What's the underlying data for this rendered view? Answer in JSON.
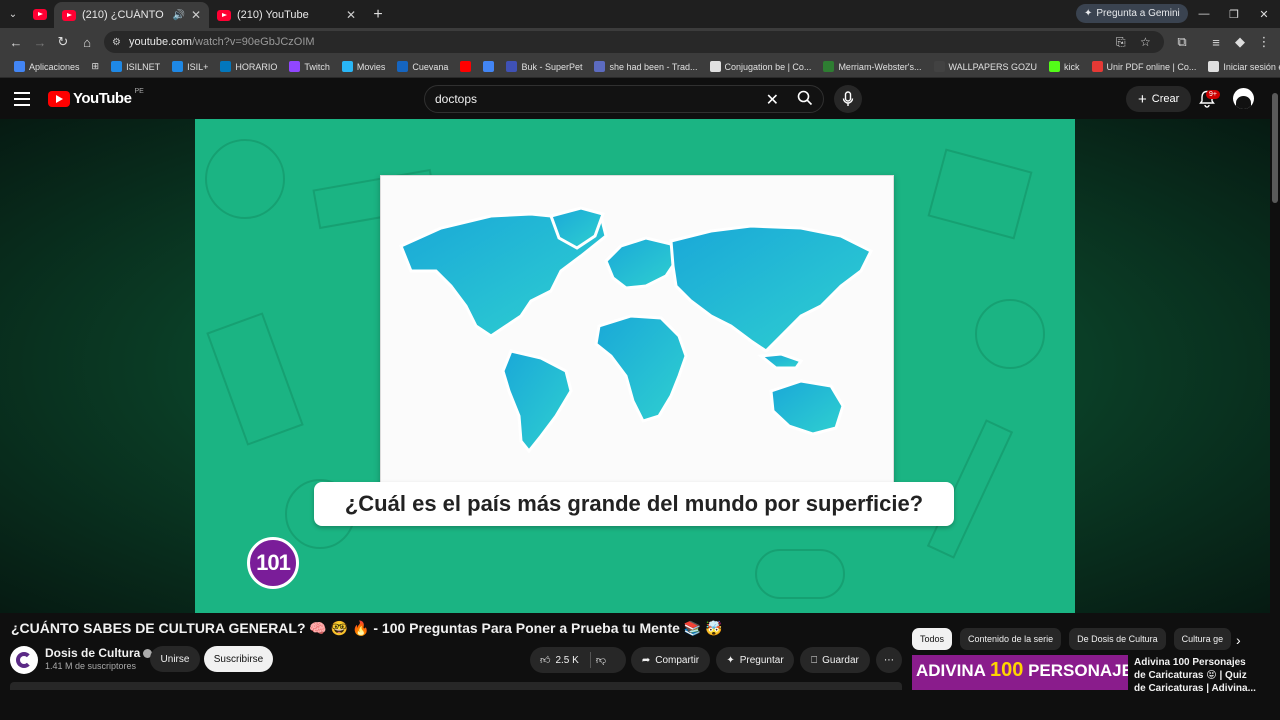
{
  "browser": {
    "tabs": [
      {
        "title": "(210) ¿CUÁNTO SABES DE CULTURA GENERAL?",
        "active": true
      },
      {
        "title": "(210) YouTube",
        "active": false
      }
    ],
    "gemini_label": "Pregunta a Gemini",
    "url_host": "youtube.com",
    "url_path": "/watch?v=90eGbJCzOIM",
    "bookmarks": [
      {
        "label": "Aplicaciones",
        "color": "#4285f4"
      },
      {
        "label": "ISILNET",
        "color": "#1e88e5"
      },
      {
        "label": "ISIL+",
        "color": "#1e88e5"
      },
      {
        "label": "HORARIO",
        "color": "#0277bd"
      },
      {
        "label": "Twitch",
        "color": "#9146ff"
      },
      {
        "label": "Movies",
        "color": "#29b6f6"
      },
      {
        "label": "Cuevana",
        "color": "#1565c0"
      },
      {
        "label": "",
        "color": "#ff0000"
      },
      {
        "label": "",
        "color": "#4285f4"
      },
      {
        "label": "Buk - SuperPet",
        "color": "#3f51b5"
      },
      {
        "label": "she had been - Trad...",
        "color": "#5c6bc0"
      },
      {
        "label": "Conjugation be | Co...",
        "color": "#e0e0e0"
      },
      {
        "label": "Merriam-Webster's...",
        "color": "#2e7d32"
      },
      {
        "label": "WALLPAPERS GOZU",
        "color": "#424242"
      },
      {
        "label": "kick",
        "color": "#53fc18"
      },
      {
        "label": "Unir PDF online | Co...",
        "color": "#e53935"
      },
      {
        "label": "Iniciar sesión en Ca...",
        "color": "#e0e0e0"
      }
    ]
  },
  "youtube": {
    "logo_text": "YouTube",
    "country_code": "PE",
    "search_value": "doctops",
    "create_label": "Crear",
    "notif_badge": "9+"
  },
  "video": {
    "question": "¿Cuál es el país más grande del mundo por superficie?",
    "number": "101",
    "title": "¿CUÁNTO SABES DE CULTURA GENERAL? 🧠 🤓 🔥 - 100 Preguntas Para Poner a Prueba tu Mente 📚 🤯",
    "channel_name": "Dosis de Cultura",
    "subscribers": "1.41 M de suscriptores",
    "join_label": "Unirse",
    "subscribe_label": "Suscribirse",
    "likes": "2.5 K",
    "share_label": "Compartir",
    "ask_label": "Preguntar",
    "save_label": "Guardar"
  },
  "sidebar": {
    "chips": [
      "Todos",
      "Contenido de la serie",
      "De Dosis de Cultura",
      "Cultura ge"
    ],
    "rec_thumb_text_a": "ADIVINA ",
    "rec_thumb_text_b": "100",
    "rec_thumb_text_c": " PERSONAJES",
    "rec_title": "Adivina 100 Personajes de Caricaturas 😝 | Quiz de Caricaturas | Adivina..."
  },
  "colors": {
    "video_bg": "#1bb483",
    "badge_purple": "#7a1d99",
    "yt_red": "#ff0000"
  }
}
